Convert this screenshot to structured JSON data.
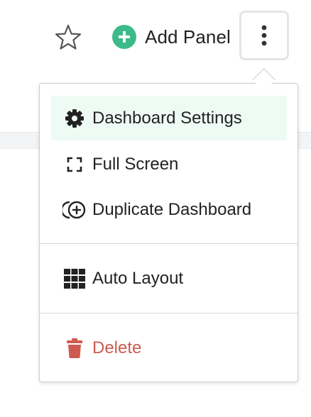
{
  "toolbar": {
    "add_panel_label": "Add Panel",
    "star_icon": "star-outline-icon",
    "add_icon": "plus-circle-icon",
    "more_icon": "vertical-ellipsis-icon"
  },
  "menu": {
    "items": [
      {
        "label": "Dashboard Settings",
        "icon": "gear-icon",
        "active": true
      },
      {
        "label": "Full Screen",
        "icon": "fullscreen-icon"
      },
      {
        "label": "Duplicate Dashboard",
        "icon": "duplicate-icon"
      },
      {
        "label": "Auto Layout",
        "icon": "grid-icon"
      },
      {
        "label": "Delete",
        "icon": "trash-icon",
        "danger": true
      }
    ]
  },
  "colors": {
    "accent": "#3cba8a",
    "active_bg": "#eefaf4",
    "danger": "#cf5a51",
    "text": "#222222",
    "border": "#c9cdd1"
  }
}
